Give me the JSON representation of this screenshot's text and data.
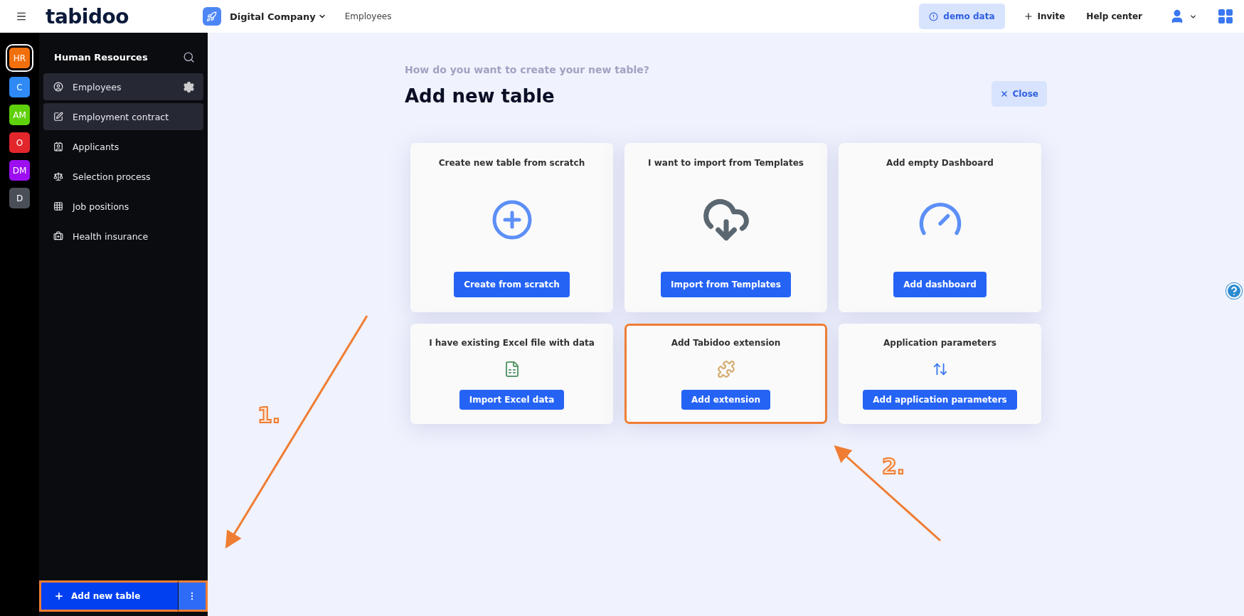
{
  "topbar": {
    "logo": "tabidoo",
    "workspace": "Digital Company",
    "breadcrumb": "Employees",
    "demo_button": "demo data",
    "invite_button": "Invite",
    "help_link": "Help center"
  },
  "rail": [
    {
      "label": "HR",
      "color": "#f2700c",
      "selected": true
    },
    {
      "label": "C",
      "color": "#2f8af5",
      "selected": false
    },
    {
      "label": "AM",
      "color": "#5fd10a",
      "selected": false
    },
    {
      "label": "O",
      "color": "#e2262b",
      "selected": false
    },
    {
      "label": "DM",
      "color": "#9d0ff0",
      "selected": false
    },
    {
      "label": "D",
      "color": "#4a4f57",
      "selected": false
    }
  ],
  "sidebar": {
    "title": "Human Resources",
    "items": [
      {
        "label": "Employees",
        "selected": true,
        "hovered": true
      },
      {
        "label": "Employment contract",
        "selected": true,
        "hovered": false
      },
      {
        "label": "Applicants",
        "selected": false,
        "hovered": false
      },
      {
        "label": "Selection process",
        "selected": false,
        "hovered": false
      },
      {
        "label": "Job positions",
        "selected": false,
        "hovered": false
      },
      {
        "label": "Health insurance",
        "selected": false,
        "hovered": false
      }
    ],
    "add_button": {
      "label": "Add new table",
      "highlighted": true
    }
  },
  "main": {
    "subtitle": "How do you want to create your new table?",
    "title": "Add new table",
    "close_button": "Close",
    "cards": [
      {
        "title": "Create new table from scratch",
        "button": "Create from scratch",
        "highlighted": false
      },
      {
        "title": "I want to import from Templates",
        "button": "Import from Templates",
        "highlighted": false
      },
      {
        "title": "Add empty Dashboard",
        "button": "Add dashboard",
        "highlighted": false
      },
      {
        "title": "I have existing Excel file with data",
        "button": "Import Excel data",
        "highlighted": false
      },
      {
        "title": "Add Tabidoo extension",
        "button": "Add extension",
        "highlighted": true
      },
      {
        "title": "Application parameters",
        "button": "Add application parameters",
        "highlighted": false
      }
    ]
  },
  "annotations": [
    {
      "label": "1."
    },
    {
      "label": "2."
    }
  ]
}
